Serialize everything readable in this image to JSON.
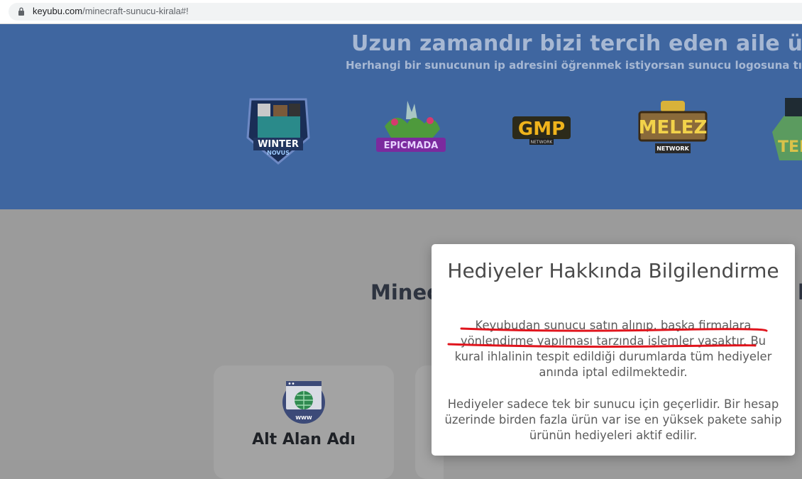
{
  "browser": {
    "url_domain": "keyubu.com",
    "url_path": "/minecraft-sunucu-kirala#!"
  },
  "hero": {
    "title": "Uzun zamandır bizi tercih eden aile üyeleri",
    "subtitle": "Herhangi bir sunucunun ip adresini öğrenmek istiyorsan sunucu logosuna tıkla!",
    "logos": [
      {
        "icon": "winter-novus-logo",
        "text1": "WINTER",
        "text2": "NOVUS"
      },
      {
        "icon": "epicmada-logo",
        "text": "EPICMADA"
      },
      {
        "icon": "gmp-network-logo",
        "text": "GMP",
        "sub": "NETWORK"
      },
      {
        "icon": "melez-network-logo",
        "text": "MELEZ",
        "sub": "NETWORK"
      },
      {
        "icon": "partial-server-logo",
        "text": "TER"
      }
    ]
  },
  "section": {
    "title": "Minecraft Sunucu Kirala"
  },
  "cards": [
    {
      "label": "Alt Alan Adı",
      "icon": "globe-browser-icon",
      "icon_text": "WWW"
    }
  ],
  "modal": {
    "title": "Hediyeler Hakkında Bilgilendirme",
    "paragraph1": "Keyubudan sunucu satın alınıp, başka firmalara yönlendirme yapılması tarzında işlemler yasaktır. Bu kural ihlalinin tespit edildiği durumlarda tüm hediyeler anında iptal edilmektedir.",
    "paragraph2": "Hediyeler sadece tek bir sunucu için geçerlidir. Bir hesap üzerinde birden fazla ürün var ise en yüksek pakete sahip ürünün hediyeleri aktif edilir.",
    "underline_color": "#e0141c"
  }
}
